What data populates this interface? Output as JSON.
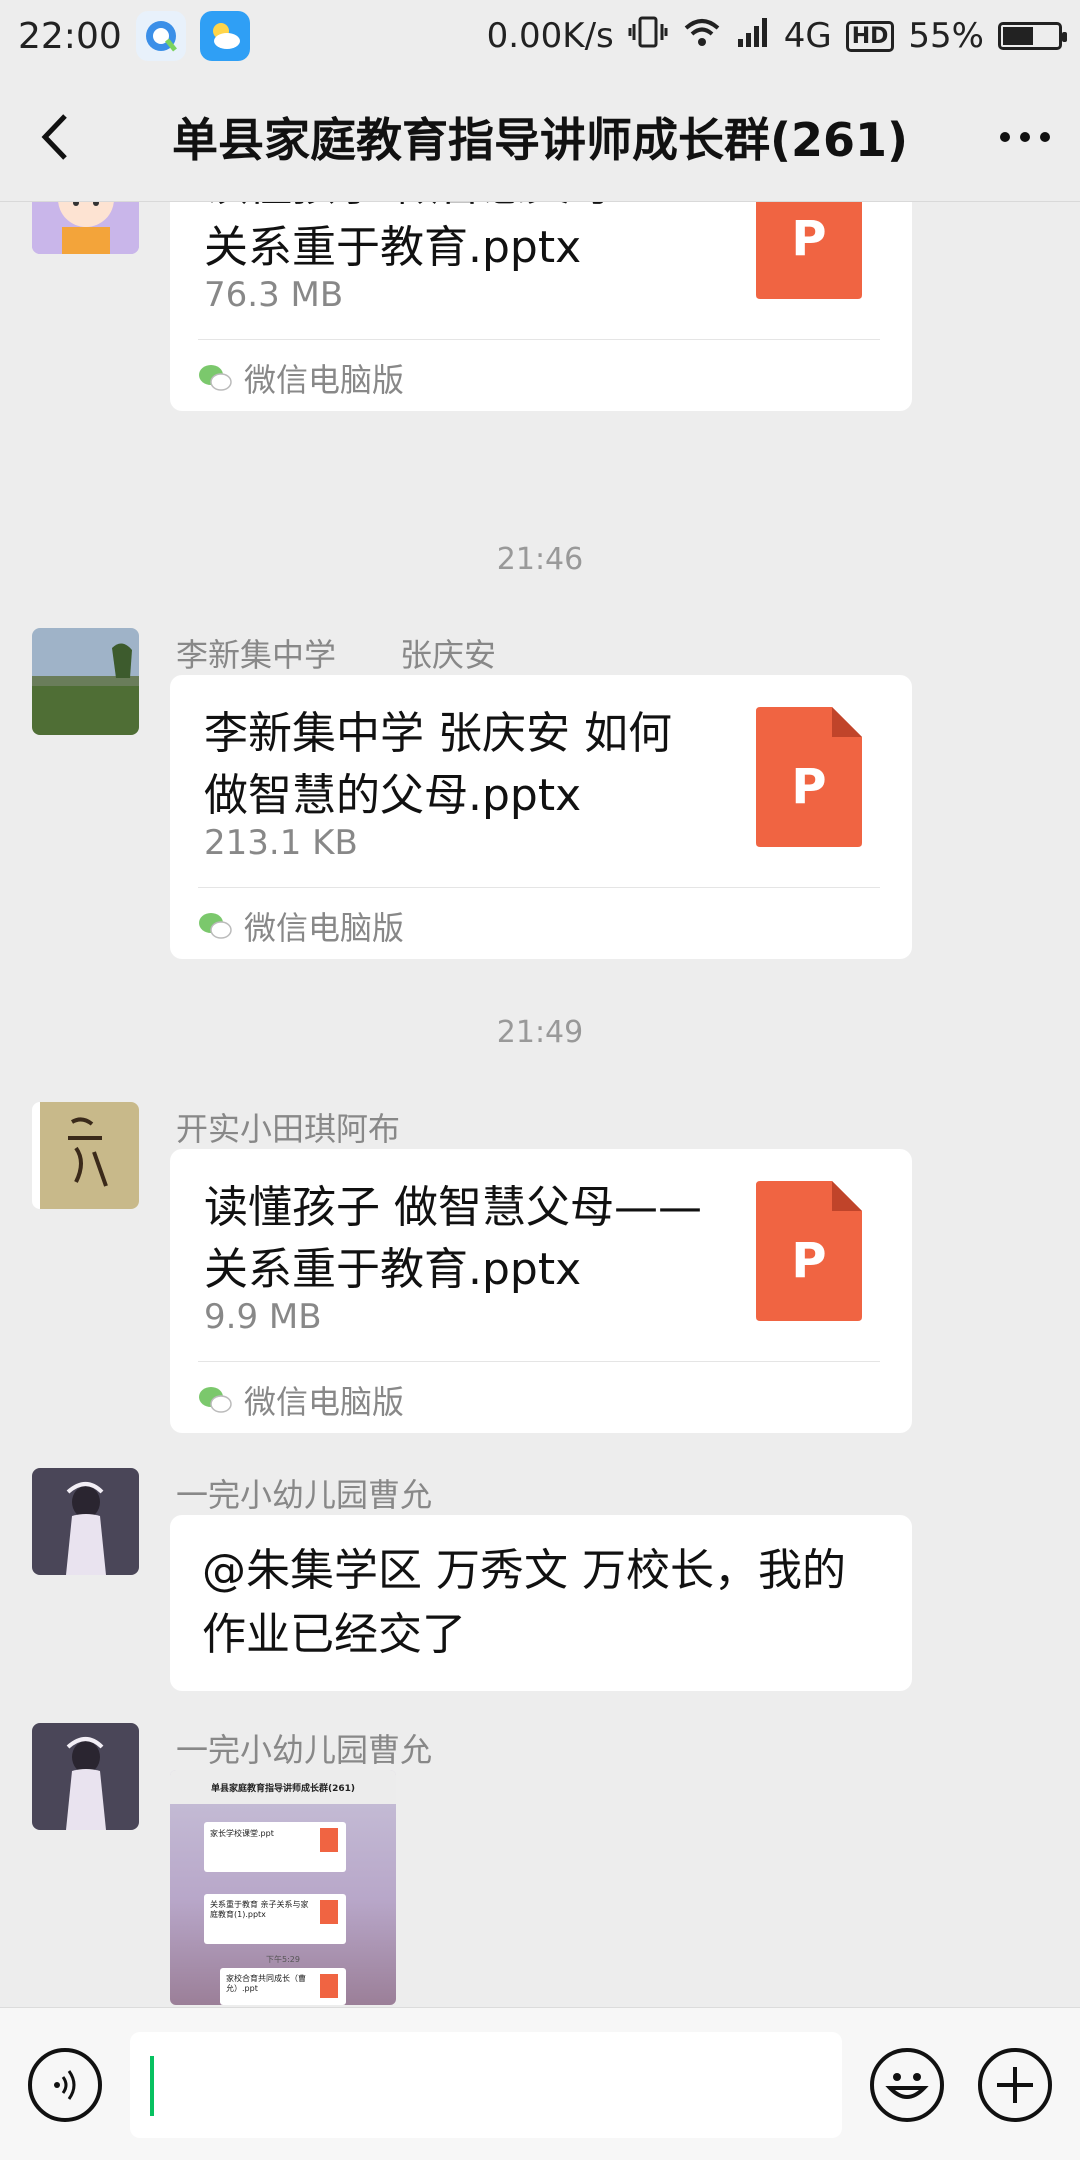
{
  "status_bar": {
    "time": "22:00",
    "network_speed": "0.00K/s",
    "network_type": "4G",
    "hd_badge": "HD",
    "battery": "55%",
    "battery_level": 0.55
  },
  "header": {
    "title": "单县家庭教育指导讲师成长群(261)"
  },
  "messages": [
    {
      "type": "file",
      "file_name": "读懂孩子 做智慧父母——关系重于教育.pptx",
      "file_size": "76.3 MB",
      "file_icon_letter": "P",
      "source": "微信电脑版"
    },
    {
      "type": "time",
      "text": "21:46"
    },
    {
      "type": "file",
      "sender": "李新集中学　　张庆安",
      "file_name": "李新集中学 张庆安 如何做智慧的父母.pptx",
      "file_size": "213.1 KB",
      "file_icon_letter": "P",
      "source": "微信电脑版"
    },
    {
      "type": "time",
      "text": "21:49"
    },
    {
      "type": "file",
      "sender": "开实小田琪阿布",
      "file_name": "读懂孩子 做智慧父母——关系重于教育.pptx",
      "file_size": "9.9 MB",
      "file_icon_letter": "P",
      "source": "微信电脑版"
    },
    {
      "type": "text",
      "sender": "一完小幼儿园曹允",
      "text": "@朱集学区 万秀文 万校长，我的作业已经交了"
    },
    {
      "type": "image",
      "sender": "一完小幼儿园曹允",
      "thumb_title": "单县家庭教育指导讲师成长群(261)",
      "thumb_file_1": "家长学校课堂.ppt",
      "thumb_file_2": "关系重于教育 亲子关系与家庭教育(1).pptx",
      "thumb_time": "下午5:29",
      "thumb_file_3": "家校合育共同成长（曹允）.ppt"
    }
  ],
  "colors": {
    "ppt_icon": "#f06442",
    "background": "#ededed",
    "bubble": "#ffffff",
    "caret": "#07c160"
  }
}
